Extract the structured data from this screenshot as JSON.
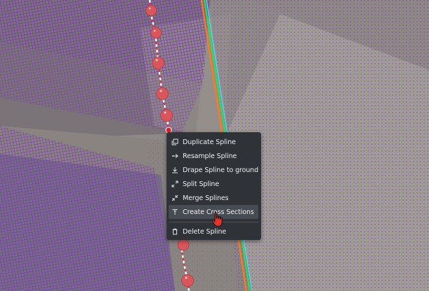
{
  "context_menu": {
    "items": [
      {
        "label": "Duplicate Spline",
        "icon": "duplicate-icon"
      },
      {
        "label": "Resample Spline",
        "icon": "resample-icon"
      },
      {
        "label": "Drape Spline to ground",
        "icon": "drape-icon"
      },
      {
        "label": "Split Spline",
        "icon": "split-icon"
      },
      {
        "label": "Merge Splines",
        "icon": "merge-icon"
      },
      {
        "label": "Create Cross Sections",
        "icon": "cross-section-icon",
        "hovered": true
      },
      {
        "label": "Delete Spline",
        "icon": "trash-icon"
      }
    ]
  },
  "colors": {
    "menu_bg": "#2f3337",
    "menu_hover": "#474c52",
    "spline_node": "#d9575c",
    "point_cloud": "#7a2fb8",
    "line_orange": "#ff7a1a",
    "line_green": "#27e05a",
    "line_cyan": "#5ad0ff"
  },
  "cursor": {
    "icon": "hand-pointer-icon"
  }
}
